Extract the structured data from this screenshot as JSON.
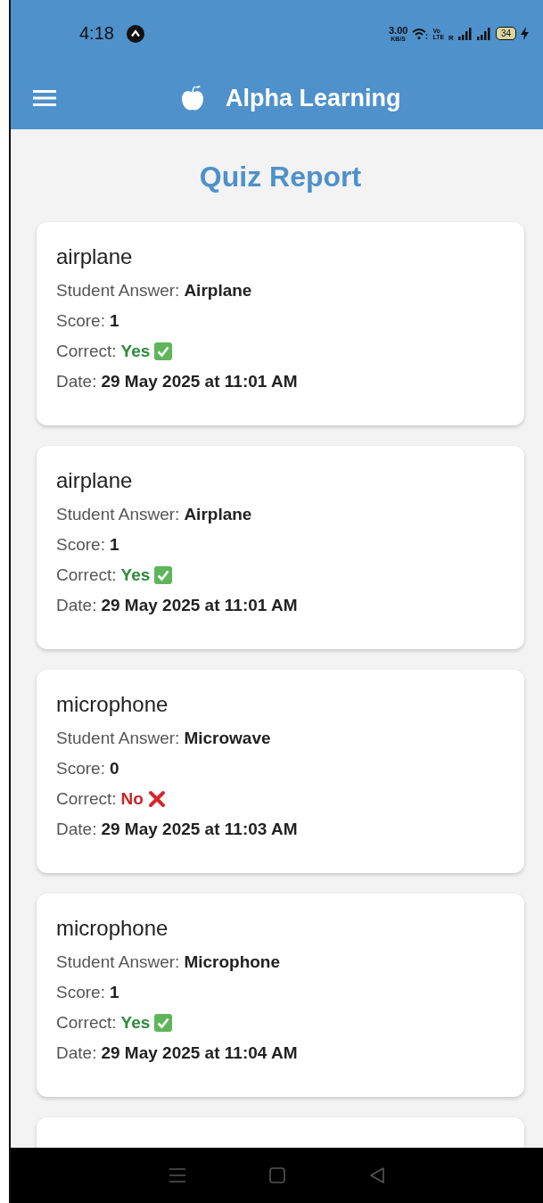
{
  "status_bar": {
    "time": "4:18",
    "speed": "3.00",
    "speed_unit": "KB/S",
    "volte_top": "Vo",
    "volte_bottom": "LTE",
    "roaming": "R",
    "battery": "34"
  },
  "header": {
    "title": "Alpha Learning"
  },
  "page_title": "Quiz Report",
  "results": [
    {
      "word": "airplane",
      "answer_label": "Student Answer:",
      "answer": "Airplane",
      "score_label": "Score:",
      "score": "1",
      "correct_label": "Correct:",
      "correct_text": "Yes",
      "correct": true,
      "date_label": "Date:",
      "date": "29 May 2025 at 11:01 AM"
    },
    {
      "word": "airplane",
      "answer_label": "Student Answer:",
      "answer": "Airplane",
      "score_label": "Score:",
      "score": "1",
      "correct_label": "Correct:",
      "correct_text": "Yes",
      "correct": true,
      "date_label": "Date:",
      "date": "29 May 2025 at 11:01 AM"
    },
    {
      "word": "microphone",
      "answer_label": "Student Answer:",
      "answer": "Microwave",
      "score_label": "Score:",
      "score": "0",
      "correct_label": "Correct:",
      "correct_text": "No",
      "correct": false,
      "date_label": "Date:",
      "date": "29 May 2025 at 11:03 AM"
    },
    {
      "word": "microphone",
      "answer_label": "Student Answer:",
      "answer": "Microphone",
      "score_label": "Score:",
      "score": "1",
      "correct_label": "Correct:",
      "correct_text": "Yes",
      "correct": true,
      "date_label": "Date:",
      "date": "29 May 2025 at 11:04 AM"
    }
  ],
  "more_below": true
}
